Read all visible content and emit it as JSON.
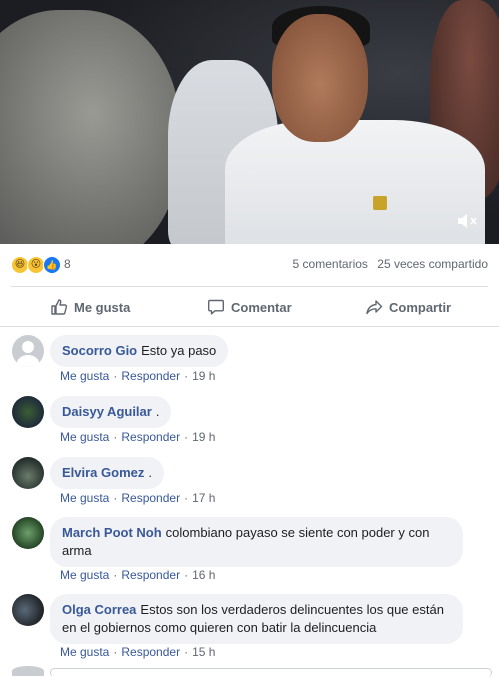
{
  "video": {
    "mute_icon": "speaker-muted-icon"
  },
  "reactions": {
    "icons": [
      "haha-icon",
      "wow-icon",
      "like-icon"
    ],
    "count": "8",
    "comments_label": "5 comentarios",
    "shares_label": "25 veces compartido"
  },
  "actions": {
    "like": "Me gusta",
    "comment": "Comentar",
    "share": "Compartir"
  },
  "comments": [
    {
      "author": "Socorro Gio",
      "text": "Esto ya paso",
      "like": "Me gusta",
      "reply": "Responder",
      "time": "19 h"
    },
    {
      "author": "Daisyy Aguilar",
      "text": ".",
      "like": "Me gusta",
      "reply": "Responder",
      "time": "19 h"
    },
    {
      "author": "Elvira Gomez",
      "text": ".",
      "like": "Me gusta",
      "reply": "Responder",
      "time": "17 h"
    },
    {
      "author": "March Poot Noh",
      "text": "colombiano payaso se siente con poder y con arma",
      "like": "Me gusta",
      "reply": "Responder",
      "time": "16 h"
    },
    {
      "author": "Olga Correa",
      "text": "Estos son los verdaderos delincuentes los que están en el gobiernos como quieren con batir la delincuencia",
      "like": "Me gusta",
      "reply": "Responder",
      "time": "15 h"
    }
  ],
  "colors": {
    "link": "#385898",
    "meta": "#606770",
    "bubble": "#f0f2f5",
    "like_blue": "#1877f2"
  }
}
